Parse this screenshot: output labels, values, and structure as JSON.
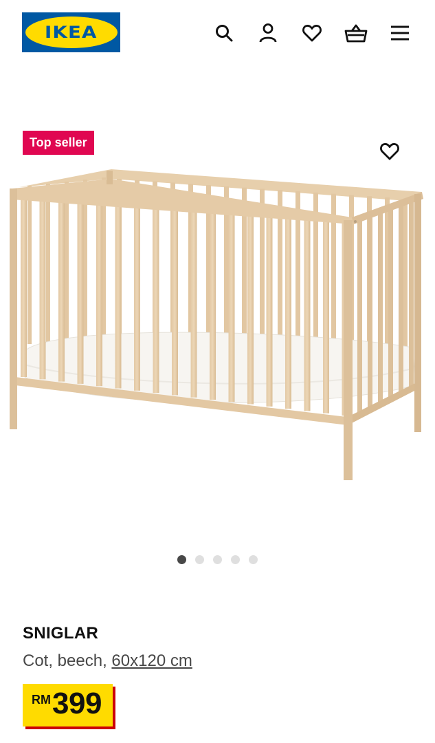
{
  "header": {
    "logo_text": "IKEA",
    "logo_mark": "®",
    "icons": [
      "search-icon",
      "profile-icon",
      "heart-icon",
      "basket-icon",
      "menu-icon"
    ]
  },
  "product": {
    "badge": "Top seller",
    "name": "SNIGLAR",
    "description_prefix": "Cot, beech, ",
    "size_link": "60x120 cm",
    "price": {
      "currency": "RM",
      "value": "399"
    }
  },
  "carousel": {
    "total": 5,
    "active_index": 0
  },
  "colors": {
    "ikea_blue": "#0058a3",
    "ikea_yellow": "#ffdb00",
    "badge_red": "#e00751",
    "price_shadow_red": "#cc0008",
    "dot_active": "#484848",
    "dot_inactive": "#dfdfdf"
  }
}
